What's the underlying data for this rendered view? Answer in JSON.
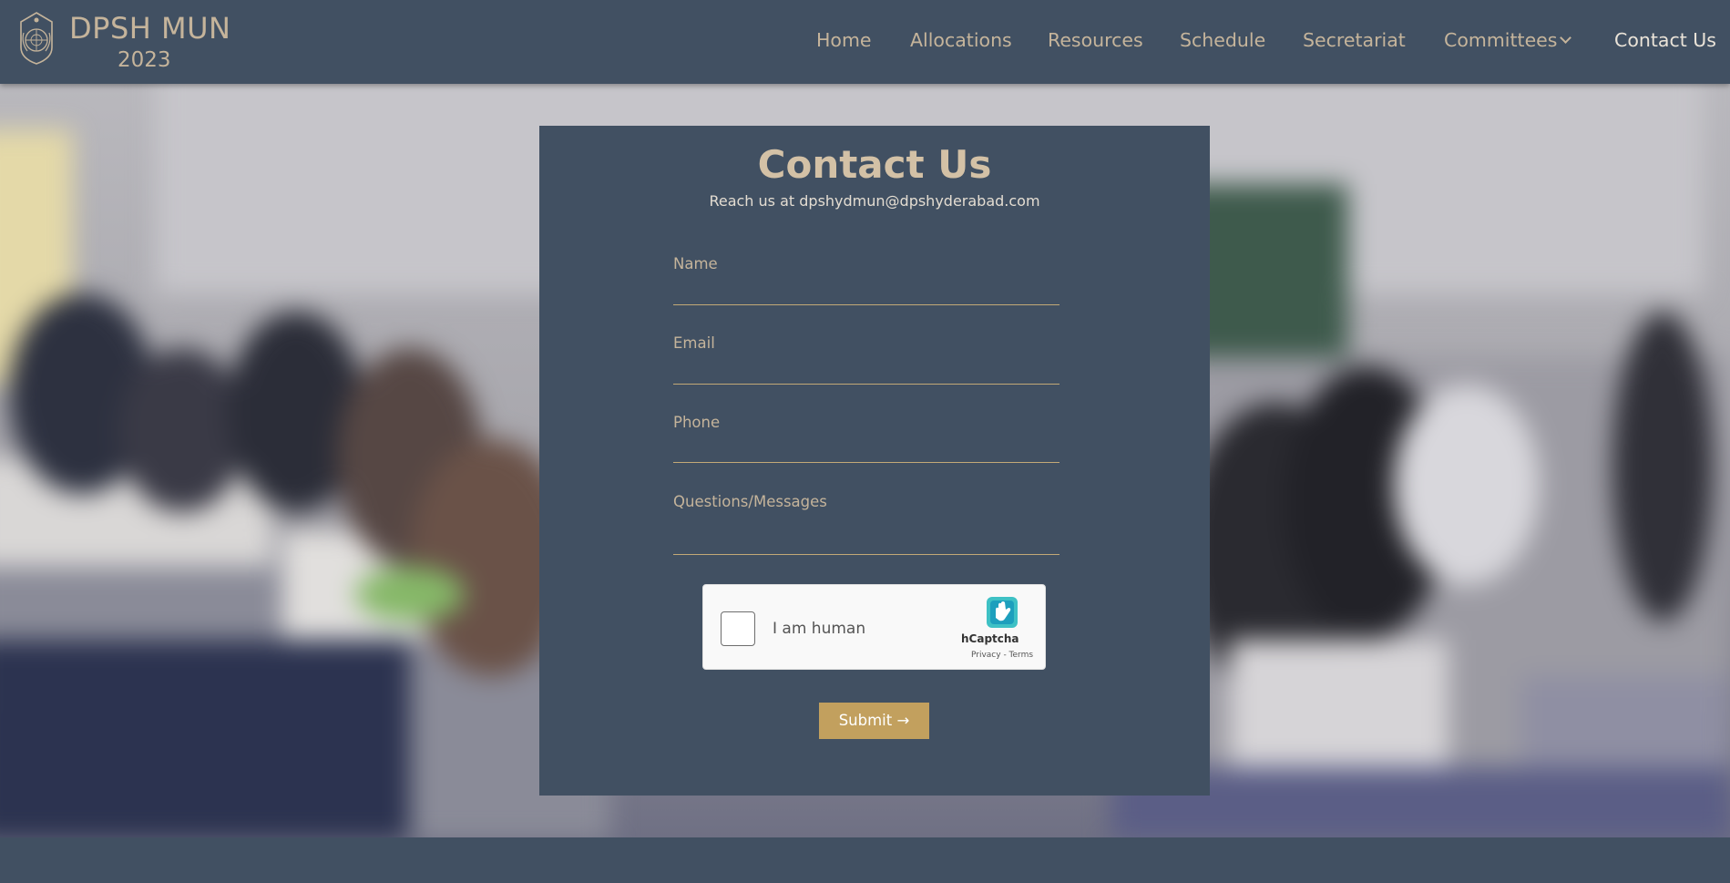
{
  "brand": {
    "name": "DPSH MUN",
    "year": "2023",
    "logo_icon": "un-emblem-icon"
  },
  "nav": {
    "items": [
      {
        "label": "Home"
      },
      {
        "label": "Allocations"
      },
      {
        "label": "Resources"
      },
      {
        "label": "Schedule"
      },
      {
        "label": "Secretariat"
      },
      {
        "label": "Committees",
        "icon": "chevron-down-icon"
      },
      {
        "label": "Contact Us",
        "active": true
      }
    ]
  },
  "contact": {
    "title": "Contact Us",
    "subtitle": "Reach us at dpshydmun@dpshyderabad.com",
    "fields": {
      "name": {
        "label": "Name",
        "value": ""
      },
      "email": {
        "label": "Email",
        "value": ""
      },
      "phone": {
        "label": "Phone",
        "value": ""
      },
      "message": {
        "label": "Questions/Messages",
        "value": ""
      }
    },
    "captcha": {
      "label": "I am human",
      "brand": "hCaptcha",
      "links": "Privacy - Terms",
      "checked": false
    },
    "submit_label": "Submit →"
  },
  "colors": {
    "header_bg": "#415062",
    "accent_gold": "#c2a05e",
    "text_tan": "#c5b49b"
  }
}
